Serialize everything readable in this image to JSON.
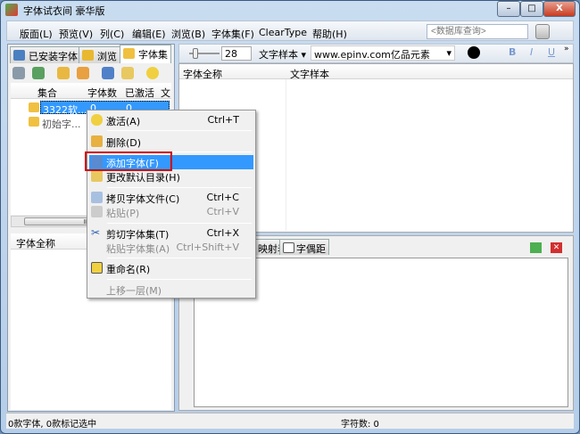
{
  "window": {
    "title": "字体试衣间 豪华版",
    "minimize": "–",
    "maximize": "□",
    "close": "X"
  },
  "menu": [
    "版面(L)",
    "预览(V)",
    "列(C)",
    "编辑(E)",
    "浏览(B)",
    "字体集(F)",
    "ClearType",
    "帮助(H)"
  ],
  "search": {
    "placeholder": "<数据库查询>"
  },
  "left_tabs": [
    "已安装字体",
    "浏览",
    "字体集"
  ],
  "collection_columns": [
    "集合",
    "字体数",
    "已激活",
    "文"
  ],
  "collections": [
    {
      "name": "3322软...",
      "count": "0",
      "active": "0"
    },
    {
      "name": "初始字...",
      "count": "",
      "active": ""
    }
  ],
  "scroll_grip": "III",
  "lower_left_header": "字体全称",
  "toolbar": {
    "size": "28",
    "sample_mode": "文字样本",
    "sample_text": "www.epinv.com亿品元素",
    "bold": "B",
    "italic": "I",
    "underline": "U",
    "more": "»"
  },
  "font_list_columns": [
    "字体全称",
    "文字样本"
  ],
  "bottom_tabs": [
    "映射表",
    "字偶距"
  ],
  "context_menu": [
    {
      "label": "激活(A)",
      "shortcut": "Ctrl+T",
      "icon": "bulb-icon"
    },
    {
      "label": "删除(D)",
      "shortcut": "",
      "icon": "delete-box-icon"
    },
    {
      "label": "添加字体(F)",
      "shortcut": "",
      "icon": "add-font-icon",
      "highlighted": true
    },
    {
      "label": "更改默认目录(H)",
      "shortcut": "",
      "icon": "folder-icon"
    },
    {
      "label": "拷贝字体文件(C)",
      "shortcut": "Ctrl+C",
      "icon": "copy-icon"
    },
    {
      "label": "粘贴(P)",
      "shortcut": "Ctrl+V",
      "icon": "paste-icon",
      "disabled": true
    },
    {
      "label": "剪切字体集(T)",
      "shortcut": "Ctrl+X",
      "icon": "scissors-icon"
    },
    {
      "label": "粘贴字体集(A)",
      "shortcut": "Ctrl+Shift+V",
      "disabled": true
    },
    {
      "label": "重命名(R)",
      "shortcut": "",
      "icon": "rename-icon"
    },
    {
      "label": "上移一层(M)",
      "shortcut": "",
      "disabled": true
    }
  ],
  "status": {
    "left": "0款字体, 0款标记选中",
    "chars": "字符数: 0"
  },
  "colors": {
    "highlight": "#3399ff",
    "red_box": "#d00000"
  }
}
